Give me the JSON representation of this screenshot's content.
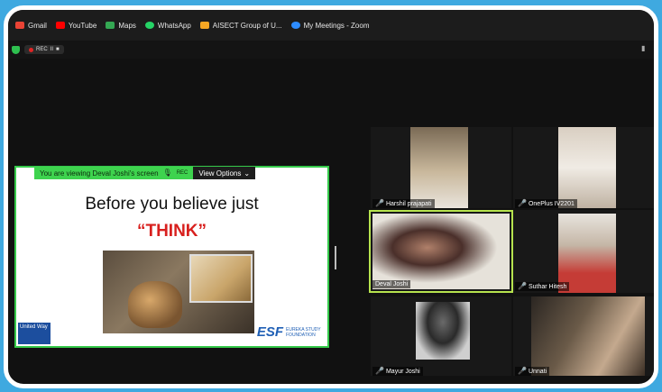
{
  "bookmarks": [
    {
      "label": "Gmail",
      "color": "#ea4335"
    },
    {
      "label": "YouTube",
      "color": "#ff0000"
    },
    {
      "label": "Maps",
      "color": "#34a853"
    },
    {
      "label": "WhatsApp",
      "color": "#25d366"
    },
    {
      "label": "AISECT Group of U...",
      "color": "#f5a623"
    },
    {
      "label": "My Meetings - Zoom",
      "color": "#2d8cff"
    }
  ],
  "zoom": {
    "rec_label": "REC",
    "pause_icon": "II",
    "stop_icon": "■"
  },
  "share": {
    "viewing_text": "You are viewing Deval Joshi's screen",
    "rec_badge": "REC",
    "view_options": "View Options",
    "slide_title": "Before you believe just",
    "slide_think": "“THINK”",
    "logo_left": "United Way",
    "logo_right": "ESF",
    "logo_right_sub": "EUREKA STUDY FOUNDATION"
  },
  "participants": [
    {
      "name": "Harshil prajapati"
    },
    {
      "name": "OnePlus IV2201"
    },
    {
      "name": "Deval Joshi"
    },
    {
      "name": "Suthar Hitesh"
    },
    {
      "name": "Mayur Joshi"
    },
    {
      "name": "Unnati"
    }
  ],
  "colors": {
    "accent_green": "#35c94a",
    "active_speaker": "#b6e34e",
    "muted": "#e53935"
  }
}
